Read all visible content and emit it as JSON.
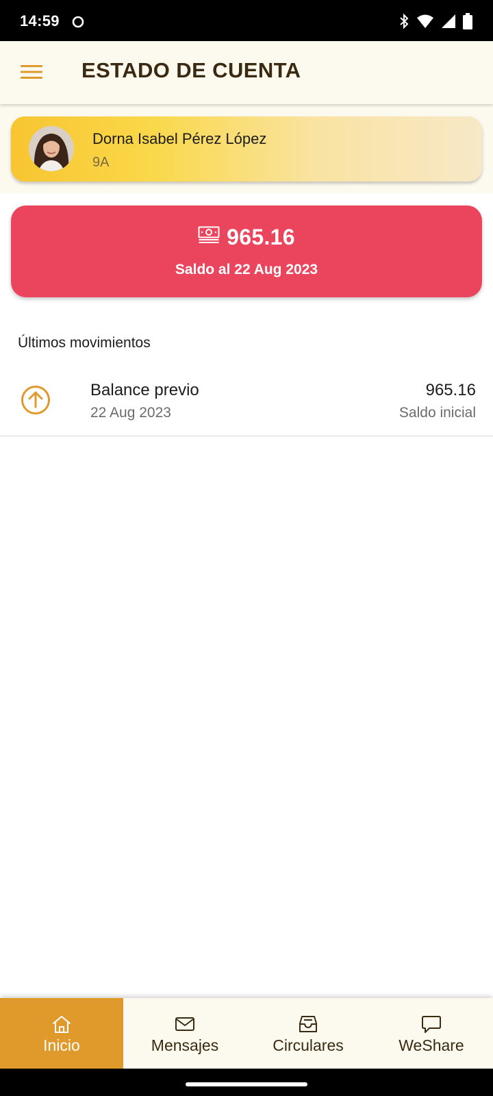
{
  "status_bar": {
    "time": "14:59",
    "icons": [
      "sync-icon",
      "bluetooth-icon",
      "wifi-icon",
      "signal-icon",
      "battery-icon"
    ]
  },
  "app_bar": {
    "title": "ESTADO DE CUENTA",
    "menu_icon": "hamburger-menu-icon",
    "icon_color": "#e09a2c"
  },
  "student": {
    "name": "Dorna Isabel Pérez López",
    "group": "9A"
  },
  "balance": {
    "amount": "965.16",
    "date_label": "Saldo al 22 Aug 2023",
    "icon": "money-icon",
    "color": "#ea455c"
  },
  "movements": {
    "section_label": "Últimos movimientos",
    "items": [
      {
        "title": "Balance previo",
        "date": "22 Aug 2023",
        "amount": "965.16",
        "type": "Saldo inicial",
        "icon": "arrow-up-circle-icon"
      }
    ]
  },
  "bottom_nav": {
    "active_color": "#e09a2c",
    "items": [
      {
        "label": "Inicio",
        "icon": "home-icon",
        "active": true
      },
      {
        "label": "Mensajes",
        "icon": "mail-icon",
        "active": false
      },
      {
        "label": "Circulares",
        "icon": "inbox-icon",
        "active": false
      },
      {
        "label": "WeShare",
        "icon": "chat-icon",
        "active": false
      }
    ]
  }
}
